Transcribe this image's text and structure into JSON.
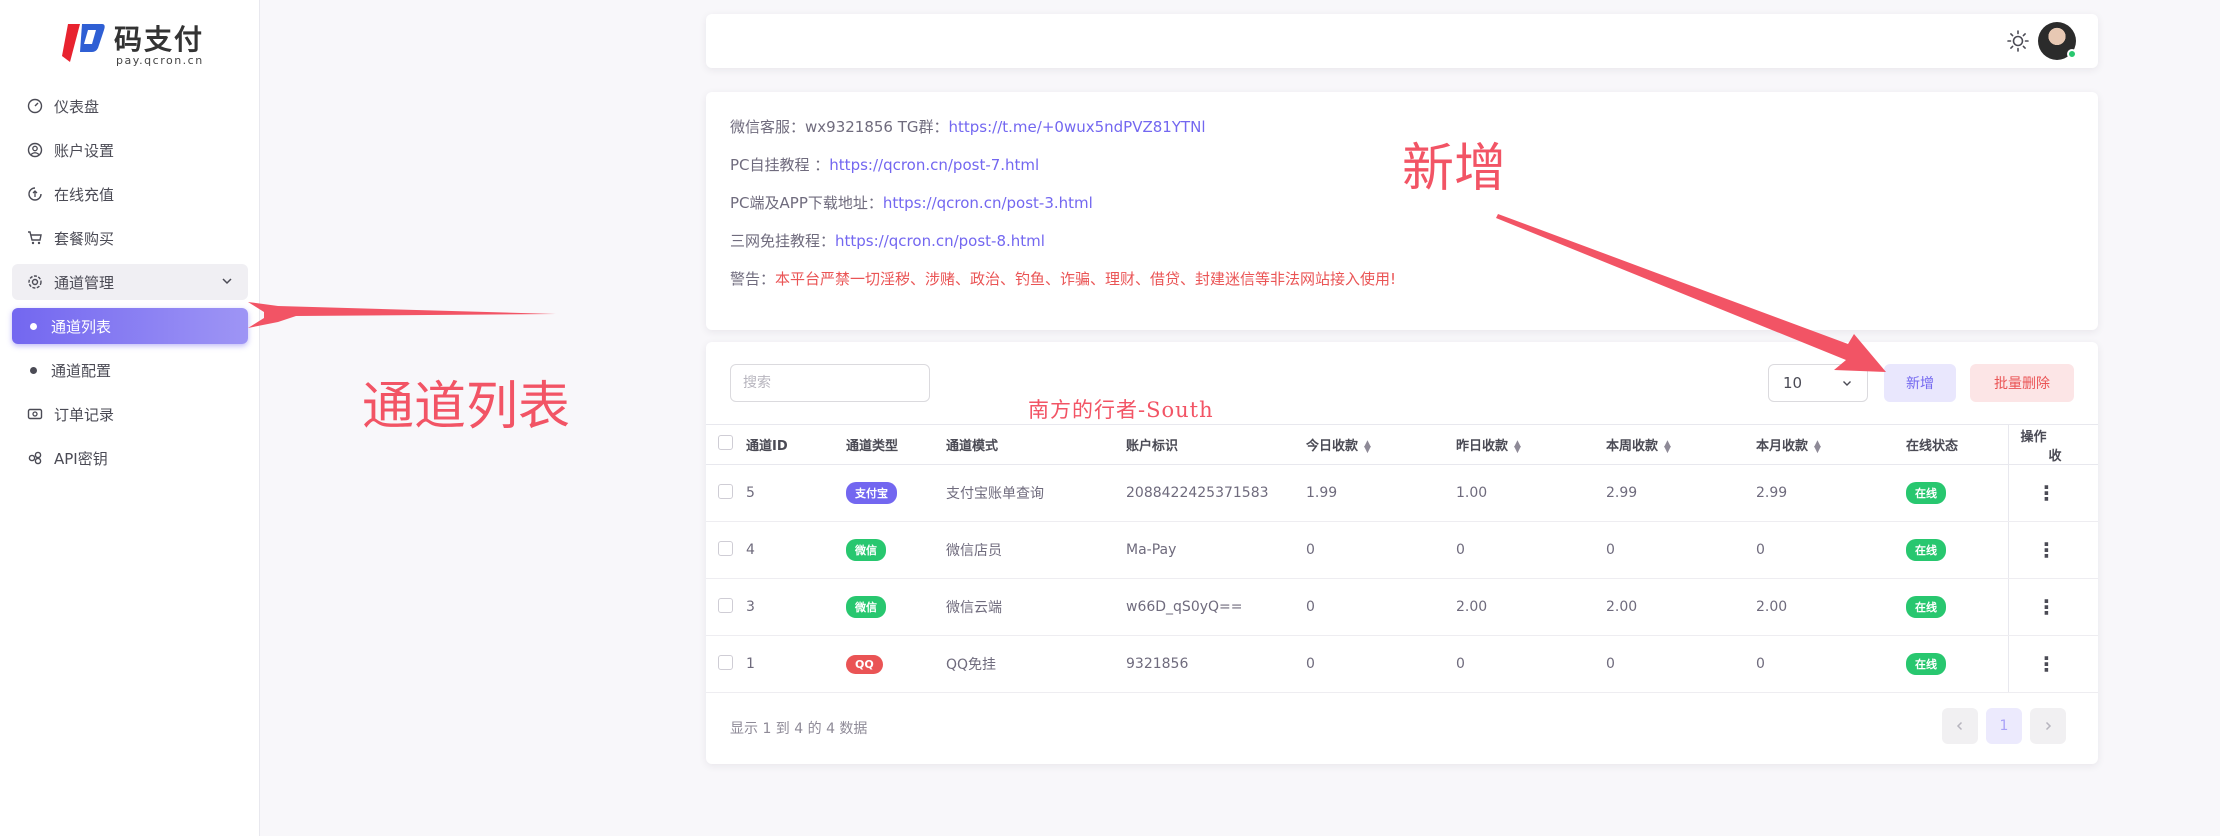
{
  "brand": {
    "name": "码支付",
    "domain": "pay.qcron.cn"
  },
  "sidebar": {
    "items": [
      {
        "label": "仪表盘",
        "icon": "dashboard-icon"
      },
      {
        "label": "账户设置",
        "icon": "user-circle-icon"
      },
      {
        "label": "在线充值",
        "icon": "recharge-icon"
      },
      {
        "label": "套餐购买",
        "icon": "cart-icon"
      },
      {
        "label": "通道管理",
        "icon": "settings-cog-icon"
      },
      {
        "label": "通道列表"
      },
      {
        "label": "通道配置"
      },
      {
        "label": "订单记录",
        "icon": "cash-icon"
      },
      {
        "label": "API密钥",
        "icon": "key-icon"
      }
    ]
  },
  "notice": {
    "line1_prefix": "微信客服：wx9321856   TG群：",
    "line1_link": "https://t.me/+0wux5ndPVZ81YTNl",
    "line2_prefix": "PC自挂教程 ：",
    "line2_link": "https://qcron.cn/post-7.html",
    "line3_prefix": "PC端及APP下载地址：",
    "line3_link": "https://qcron.cn/post-3.html",
    "line4_prefix": "三网免挂教程：",
    "line4_link": "https://qcron.cn/post-8.html",
    "warning_prefix": "警告：",
    "warning_text": "本平台严禁一切淫秽、涉赌、政治、钓鱼、诈骗、理财、借贷、封建迷信等非法网站接入使用!"
  },
  "toolbar": {
    "search_placeholder": "搜索",
    "page_size": "10",
    "add_label": "新增",
    "batch_delete_label": "批量删除"
  },
  "table": {
    "headers": {
      "id": "通道ID",
      "type": "通道类型",
      "mode": "通道模式",
      "account": "账户标识",
      "today": "今日收款",
      "yesterday": "昨日收款",
      "week": "本周收款",
      "month": "本月收款",
      "status": "在线状态",
      "ops": "操作",
      "cut": "收"
    },
    "rows": [
      {
        "id": "5",
        "type": "支付宝",
        "type_color": "purple",
        "mode": "支付宝账单查询",
        "account": "2088422425371583",
        "today": "1.99",
        "yesterday": "1.00",
        "week": "2.99",
        "month": "2.99",
        "status": "在线"
      },
      {
        "id": "4",
        "type": "微信",
        "type_color": "green",
        "mode": "微信店员",
        "account": "Ma-Pay",
        "today": "0",
        "yesterday": "0",
        "week": "0",
        "month": "0",
        "status": "在线"
      },
      {
        "id": "3",
        "type": "微信",
        "type_color": "green",
        "mode": "微信云端",
        "account": "w66D_qS0yQ==",
        "today": "0",
        "yesterday": "2.00",
        "week": "2.00",
        "month": "2.00",
        "status": "在线"
      },
      {
        "id": "1",
        "type": "QQ",
        "type_color": "red",
        "mode": "QQ免挂",
        "account": "9321856",
        "today": "0",
        "yesterday": "0",
        "week": "0",
        "month": "0",
        "status": "在线"
      }
    ]
  },
  "footer": {
    "summary": "显示 1 到 4 的 4 数据",
    "current_page": "1"
  },
  "annotations": {
    "list_label": "通道列表",
    "add_label": "新增",
    "watermark": "南方的行者-South"
  },
  "colors": {
    "primary": "#7367f0",
    "success": "#28c76f",
    "danger": "#ea5455",
    "annotation": "#f25465"
  }
}
